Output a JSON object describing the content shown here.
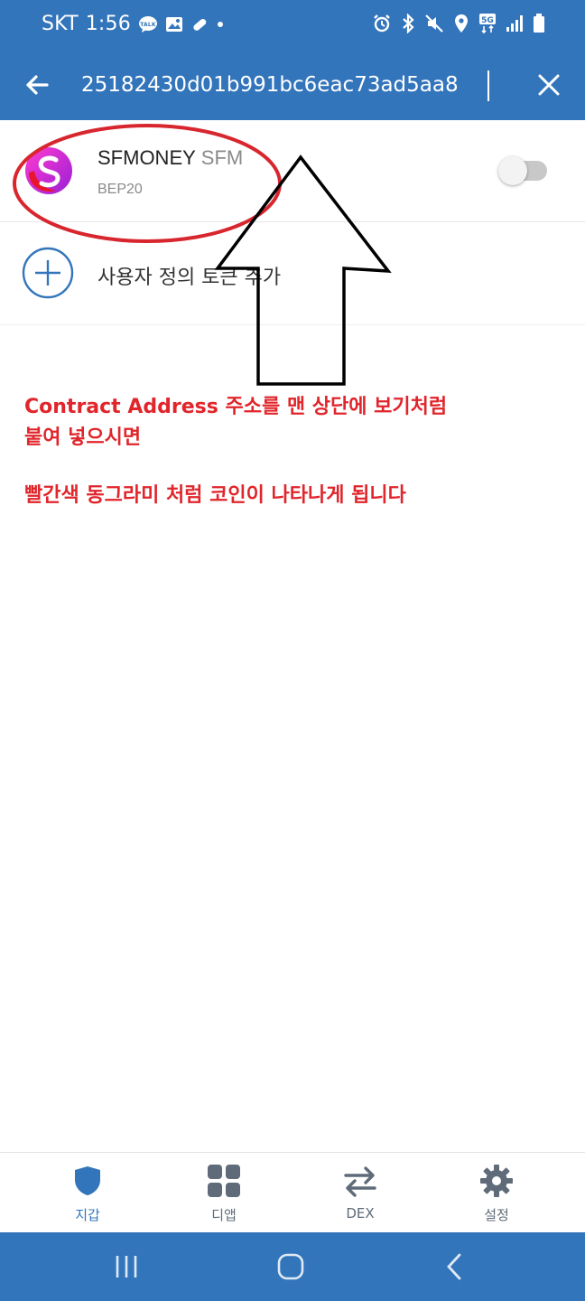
{
  "status_bar": {
    "carrier": "SKT",
    "time": "1:56",
    "talk_badge": "TALK",
    "network_badge": "5G"
  },
  "search": {
    "value": "25182430d01b991bc6eac73ad5aa8"
  },
  "token": {
    "name": "SFMONEY",
    "symbol": "SFM",
    "network": "BEP20",
    "enabled": false
  },
  "add_custom_token": {
    "label": "사용자 정의 토큰 추가"
  },
  "annotations": {
    "line1": "Contract Address 주소를 맨 상단에 보기처럼",
    "line2": "붙여 넣으시면",
    "line3": "빨간색 동그라미 처럼  코인이 나타나게 됩니다"
  },
  "bottom_nav": {
    "items": [
      {
        "label": "지갑",
        "icon": "shield-icon",
        "active": true
      },
      {
        "label": "디앱",
        "icon": "grid-icon",
        "active": false
      },
      {
        "label": "DEX",
        "icon": "swap-arrows-icon",
        "active": false
      },
      {
        "label": "설정",
        "icon": "gear-icon",
        "active": false
      }
    ]
  },
  "colors": {
    "brand": "#3375bb",
    "annotation": "#e0252b",
    "active_nav": "#3375bb",
    "inactive_nav": "#5f6b78"
  }
}
